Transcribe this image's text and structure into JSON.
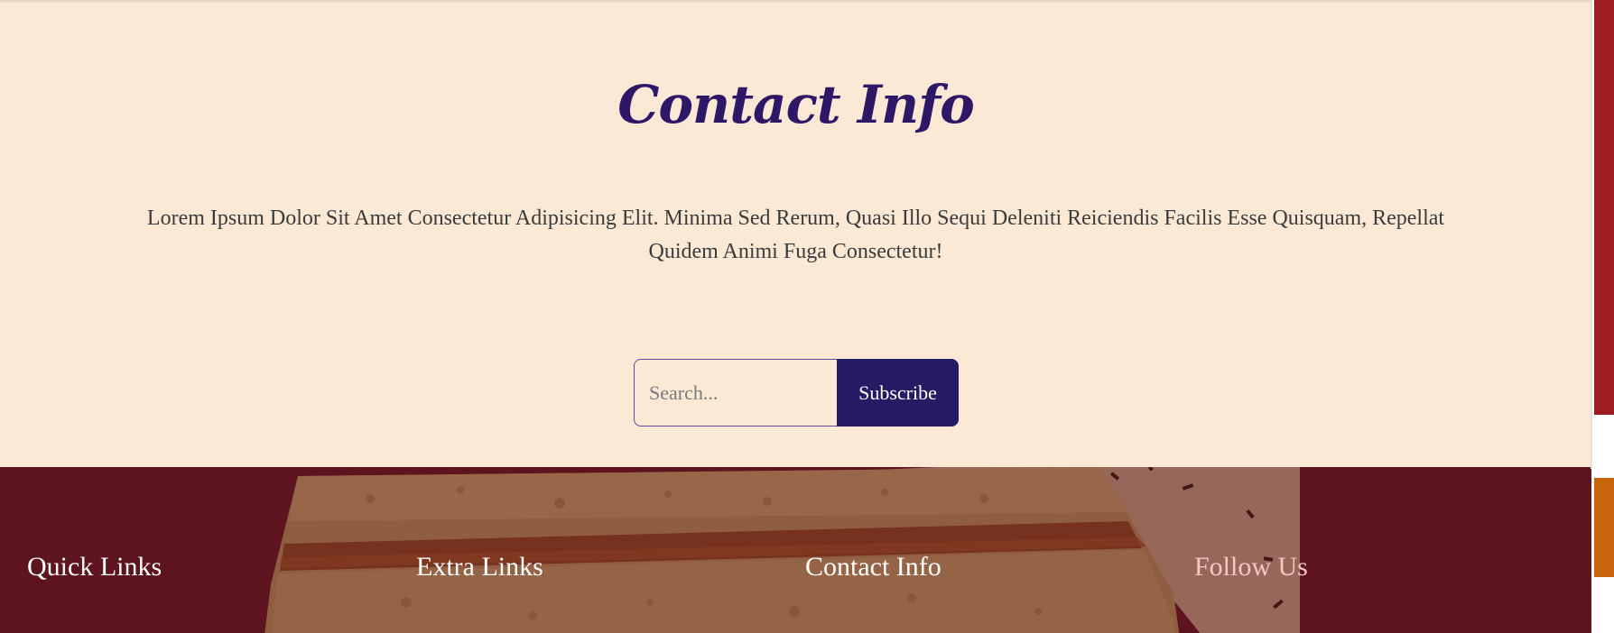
{
  "contact": {
    "title": "Contact Info",
    "description": "Lorem Ipsum Dolor Sit Amet Consectetur Adipisicing Elit. Minima Sed Rerum, Quasi Illo Sequi Deleniti Reiciendis Facilis Esse Quisquam, Repellat Quidem Animi Fuga Consectetur!",
    "search_placeholder": "Search...",
    "subscribe_label": "Subscribe"
  },
  "footer": {
    "headings": [
      "Quick Links",
      "Extra Links",
      "Contact Info",
      "Follow Us"
    ]
  },
  "colors": {
    "section_bg": "#fbe9d5",
    "title": "#2d1766",
    "button": "#241b64",
    "footer_bg": "#5e141f"
  }
}
